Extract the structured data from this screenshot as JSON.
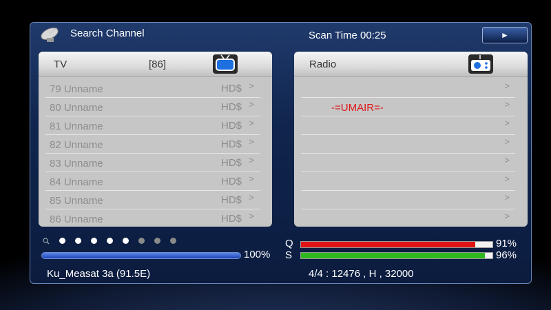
{
  "header": {
    "title": "Search Channel",
    "scan_time": "Scan Time  00:25",
    "play_symbol": "►"
  },
  "tv_panel": {
    "label": "TV",
    "count": "[86]",
    "channels": [
      {
        "name": "79 Unname",
        "tag": "HD$"
      },
      {
        "name": "80 Unname",
        "tag": "HD$"
      },
      {
        "name": "81 Unname",
        "tag": "HD$"
      },
      {
        "name": "82 Unname",
        "tag": "HD$"
      },
      {
        "name": "83 Unname",
        "tag": "HD$"
      },
      {
        "name": "84 Unname",
        "tag": "HD$"
      },
      {
        "name": "85 Unname",
        "tag": "HD$"
      },
      {
        "name": "86 Unname",
        "tag": "HD$"
      }
    ]
  },
  "radio_panel": {
    "label": "Radio",
    "channels": [
      {
        "name": ""
      },
      {
        "name": "-=UMAIR=-"
      },
      {
        "name": ""
      },
      {
        "name": ""
      },
      {
        "name": ""
      },
      {
        "name": ""
      },
      {
        "name": ""
      },
      {
        "name": ""
      }
    ]
  },
  "arrow_symbol": ">",
  "page_dots": {
    "active": 5,
    "total": 8
  },
  "scan_progress": {
    "value": 100,
    "label": "100%"
  },
  "quality": {
    "label": "Q",
    "value": 91,
    "text": "91%",
    "color": "#e01414"
  },
  "strength": {
    "label": "S",
    "value": 96,
    "text": "96%",
    "color": "#2fb81f"
  },
  "footer": {
    "satellite": "Ku_Measat 3a (91.5E)",
    "transponder": "4/4 : 12476 , H , 32000"
  }
}
